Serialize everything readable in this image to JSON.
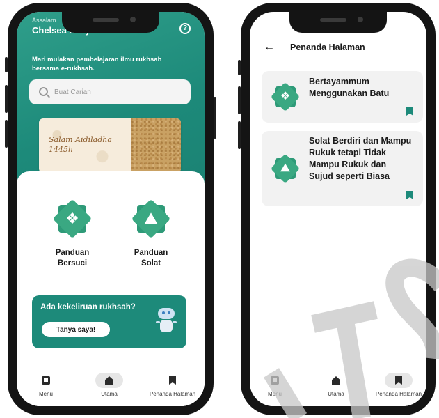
{
  "left_screen": {
    "greeting_small": "Assalam...",
    "user_name": "Chelsea Rezyka",
    "help_icon": "question-circle-icon",
    "intro_text": "Mari mulakan pembelajaran ilmu rukhsah bersama e-rukhsah.",
    "search": {
      "placeholder": "Buat Carian",
      "value": ""
    },
    "banner": {
      "title_line1": "Salam Aidiladha",
      "title_line2": "1445h"
    },
    "guides": [
      {
        "label_line1": "Panduan",
        "label_line2": "Bersuci",
        "icon": "hands-water-icon"
      },
      {
        "label_line1": "Panduan",
        "label_line2": "Solat",
        "icon": "prayer-icon"
      }
    ],
    "ask_card": {
      "title": "Ada kekeliruan rukhsah?",
      "button_label": "Tanya saya!",
      "icon": "robot-icon"
    },
    "nav": [
      {
        "label": "Menu",
        "icon": "menu-icon",
        "active": false
      },
      {
        "label": "Utama",
        "icon": "home-icon",
        "active": true
      },
      {
        "label": "Penanda Halaman",
        "icon": "bookmark-icon",
        "active": false
      }
    ]
  },
  "right_screen": {
    "title": "Penanda Halaman",
    "back_icon": "arrow-left-icon",
    "bookmarks": [
      {
        "title_lines": [
          "Bertayammum",
          "Menggunakan Batu"
        ],
        "icon": "hands-water-icon"
      },
      {
        "title_lines": [
          "Solat Berdiri dan Mampu",
          "Rukuk tetapi Tidak",
          "Mampu Rukuk dan",
          "Sujud seperti Biasa"
        ],
        "icon": "prayer-icon"
      }
    ],
    "nav": [
      {
        "label": "Menu",
        "icon": "menu-icon",
        "active": false
      },
      {
        "label": "Utama",
        "icon": "home-icon",
        "active": false
      },
      {
        "label": "Penanda Halaman",
        "icon": "bookmark-icon",
        "active": true
      }
    ]
  },
  "colors": {
    "primary": "#1d8a7a",
    "hero_light": "#2f9e8a",
    "badge_green": "#2e9a78",
    "card_bg": "#f2f2f2"
  }
}
